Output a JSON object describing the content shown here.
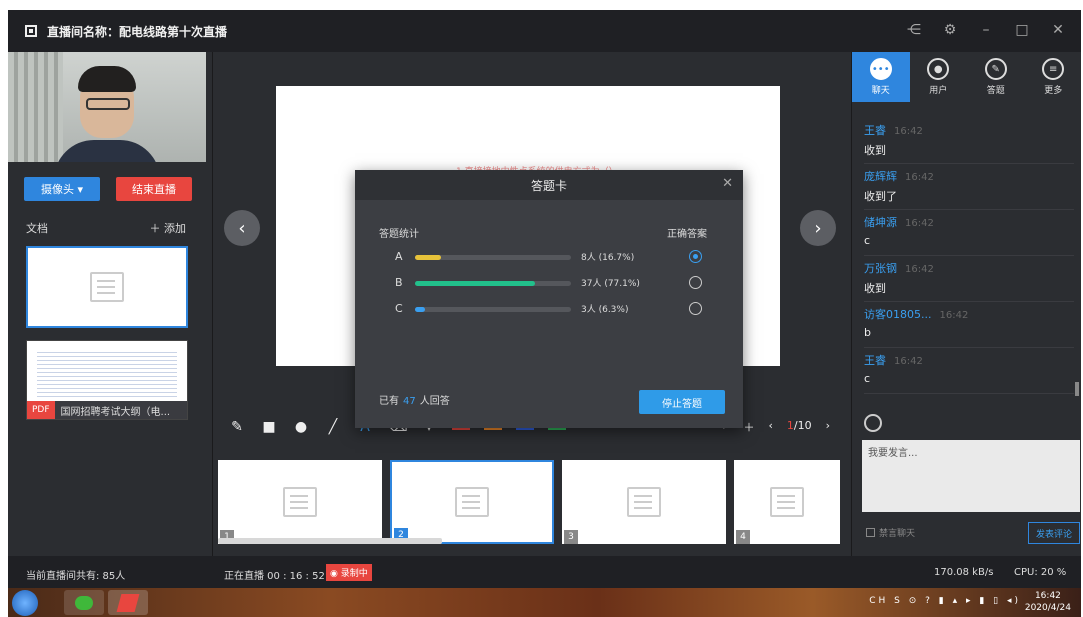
{
  "window": {
    "title": "直播间名称：配电线路第十次直播",
    "controls": [
      "share-icon",
      "settings-icon",
      "minimize-icon",
      "maximize-icon",
      "close-icon"
    ]
  },
  "left": {
    "camera_button": "摄像头 ▾",
    "end_button": "结束直播",
    "docs_label": "文档",
    "add_label": "＋ 添加",
    "doc2_tag": "PDF",
    "doc2_name": "国网招聘考试大纲（电..."
  },
  "center": {
    "slide_text": "1.直接接地中性点系统的供电方式为（）",
    "page_current": "1",
    "page_total": "/10",
    "thumbs": [
      "1",
      "2",
      "3",
      "4"
    ],
    "colors": [
      "#e8463f",
      "#f0892a",
      "#2f5fe0",
      "#2fb35a"
    ]
  },
  "modal": {
    "title": "答题卡",
    "stats_label": "答题统计",
    "correct_label": "正确答案",
    "options": [
      {
        "label": "A",
        "count": "8人 (16.7%)",
        "percent": 16.7,
        "color": "#e6c23a",
        "correct": true
      },
      {
        "label": "B",
        "count": "37人 (77.1%)",
        "percent": 77.1,
        "color": "#22c08b",
        "correct": false
      },
      {
        "label": "C",
        "count": "3人 (6.3%)",
        "percent": 6.3,
        "color": "#3a9ff0",
        "correct": false
      }
    ],
    "answered_prefix": "已有",
    "answered_count": "47",
    "answered_suffix": "人回答",
    "stop_button": "停止答题"
  },
  "right": {
    "tabs": [
      {
        "label": "聊天",
        "icon": "chat-icon"
      },
      {
        "label": "用户",
        "icon": "users-icon"
      },
      {
        "label": "答题",
        "icon": "pen-icon"
      },
      {
        "label": "更多",
        "icon": "menu-icon"
      }
    ],
    "messages": [
      {
        "name": "王睿",
        "time": "16:42",
        "text": "收到"
      },
      {
        "name": "庞辉辉",
        "time": "16:42",
        "text": "收到了"
      },
      {
        "name": "储坤源",
        "time": "16:42",
        "text": "c"
      },
      {
        "name": "万张钢",
        "time": "16:42",
        "text": "收到"
      },
      {
        "name": "访客01805...",
        "time": "16:42",
        "text": "b"
      },
      {
        "name": "王睿",
        "time": "16:42",
        "text": "c"
      }
    ],
    "input_placeholder": "我要发言...",
    "ban_label": "禁言聊天",
    "send_button": "发表评论"
  },
  "status": {
    "online": "当前直播间共有: 85人",
    "live_time": "正在直播 00 : 16 : 52",
    "recording": "◉ 录制中",
    "speed": "170.08 kB/s",
    "cpu": "CPU: 20 %"
  },
  "taskbar": {
    "tray": "CH S ⊙ ? ▮ ▴ ▸ ▮ ▯ ◂)",
    "time": "16:42",
    "date": "2020/4/24"
  }
}
